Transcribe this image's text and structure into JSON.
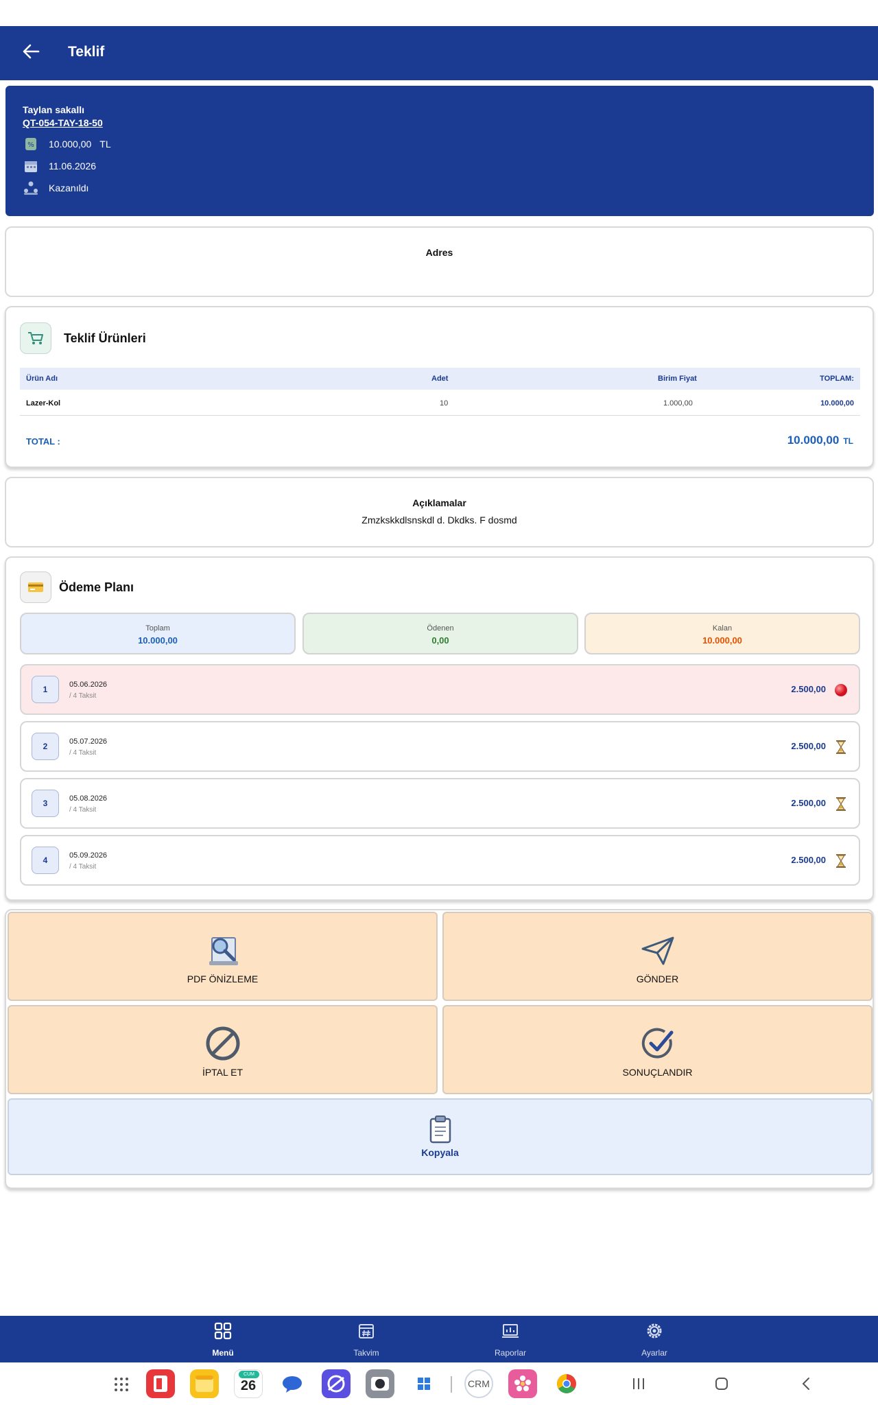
{
  "appbar": {
    "title": "Teklif"
  },
  "header": {
    "customer": "Taylan sakallı",
    "code": "QT-054-TAY-18-50",
    "amount": "10.000,00",
    "currency": "TL",
    "date": "11.06.2026",
    "status": "Kazanıldı"
  },
  "address": {
    "title": "Adres"
  },
  "products": {
    "title": "Teklif Ürünleri",
    "columns": [
      "Ürün Adı",
      "Adet",
      "Birim Fiyat",
      "TOPLAM:"
    ],
    "rows": [
      {
        "name": "Lazer-Kol",
        "qty": "10",
        "unit": "1.000,00",
        "total": "10.000,00"
      }
    ],
    "total_label": "TOTAL :",
    "total_value": "10.000,00",
    "total_currency": "TL"
  },
  "notes": {
    "title": "Açıklamalar",
    "text": "Zmzkskkdlsnskdl d. Dkdks. F dosmd"
  },
  "payment": {
    "title": "Ödeme Planı",
    "summary": [
      {
        "label": "Toplam",
        "value": "10.000,00",
        "color": "#1b5fb8",
        "bg": "#e6effb"
      },
      {
        "label": "Ödenen",
        "value": "0,00",
        "color": "#2e7d32",
        "bg": "#e8f3e8"
      },
      {
        "label": "Kalan",
        "value": "10.000,00",
        "color": "#e65100",
        "bg": "#fdf0dd"
      }
    ],
    "installments": [
      {
        "no": "1",
        "date": "05.06.2026",
        "sub": "/ 4 Taksit",
        "amount": "2.500,00",
        "status": "overdue"
      },
      {
        "no": "2",
        "date": "05.07.2026",
        "sub": "/ 4 Taksit",
        "amount": "2.500,00",
        "status": "pending"
      },
      {
        "no": "3",
        "date": "05.08.2026",
        "sub": "/ 4 Taksit",
        "amount": "2.500,00",
        "status": "pending"
      },
      {
        "no": "4",
        "date": "05.09.2026",
        "sub": "/ 4 Taksit",
        "amount": "2.500,00",
        "status": "pending"
      }
    ]
  },
  "actions": {
    "pdf": "PDF ÖNİZLEME",
    "send": "GÖNDER",
    "cancel": "İPTAL ET",
    "finalize": "SONUÇLANDIR",
    "copy": "Kopyala"
  },
  "bottom_nav": [
    {
      "label": "Menü",
      "icon": "grid-icon",
      "active": true
    },
    {
      "label": "Takvim",
      "icon": "calendar-icon",
      "active": false
    },
    {
      "label": "Raporlar",
      "icon": "reports-icon",
      "active": false
    },
    {
      "label": "Ayarlar",
      "icon": "settings-icon",
      "active": false
    }
  ],
  "dock": {
    "calendar_day": "CUM",
    "calendar_date": "26",
    "crm_label": "CRM"
  },
  "colors": {
    "primary": "#1b3b92",
    "action_bg": "#fde2c3",
    "copy_bg": "#e6effb",
    "overdue_bg": "#fde8ea"
  }
}
